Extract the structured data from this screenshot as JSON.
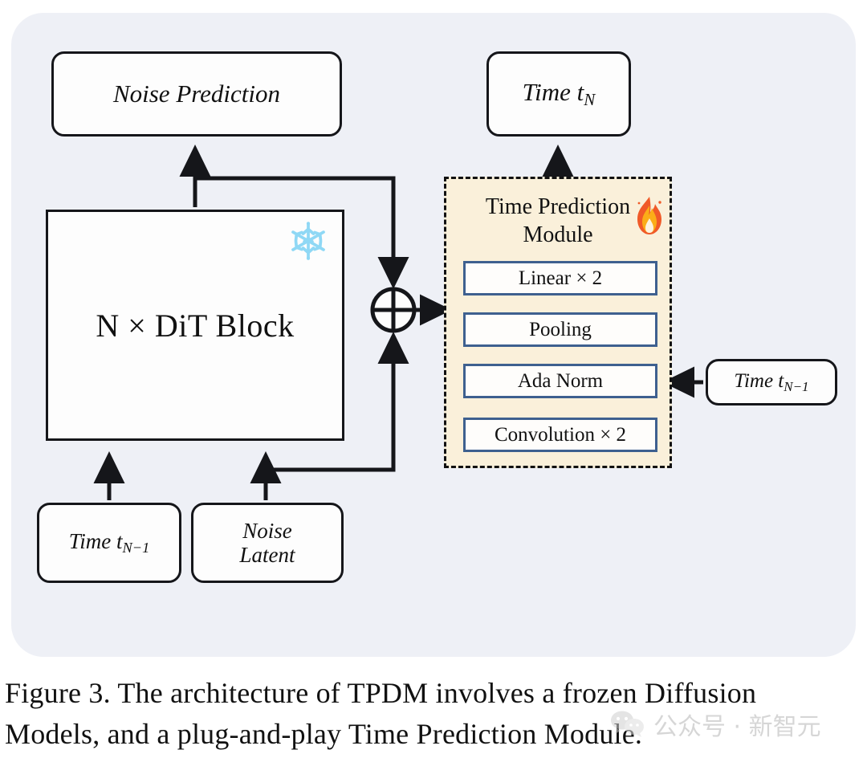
{
  "figure": {
    "panel_bg": "#eef0f6",
    "module_bg": "#faf0da",
    "subbox_border": "#3e608f",
    "line_color": "#15161a",
    "snow_color": "#8fd8f5"
  },
  "boxes": {
    "noise_prediction": "Noise Prediction",
    "time_tn": {
      "prefix": "Time t",
      "subscript": "N"
    },
    "dit_block": "N × DiT Block",
    "time_tn1_left": {
      "prefix": "Time t",
      "subscript": "N−1"
    },
    "noise_latent_line1": "Noise",
    "noise_latent_line2": "Latent",
    "time_tn1_right": {
      "prefix": "Time t",
      "subscript": "N−1"
    }
  },
  "module": {
    "title_line1": "Time Prediction",
    "title_line2": "Module",
    "fire_icon": "fire-icon",
    "snowflake_icon": "snowflake-icon",
    "layers": [
      {
        "label": "Linear × 2"
      },
      {
        "label": "Pooling"
      },
      {
        "label": "Ada Norm"
      },
      {
        "label": "Convolution × 2"
      }
    ]
  },
  "operators": {
    "sum_symbol": "circled-plus-icon"
  },
  "caption": {
    "line1": "Figure 3.  The architecture of TPDM involves a frozen Diffusion",
    "line2": "Models, and a plug-and-play Time Prediction Module."
  },
  "watermark": {
    "icon": "wechat-icon",
    "text": "公众号 · 新智元"
  }
}
